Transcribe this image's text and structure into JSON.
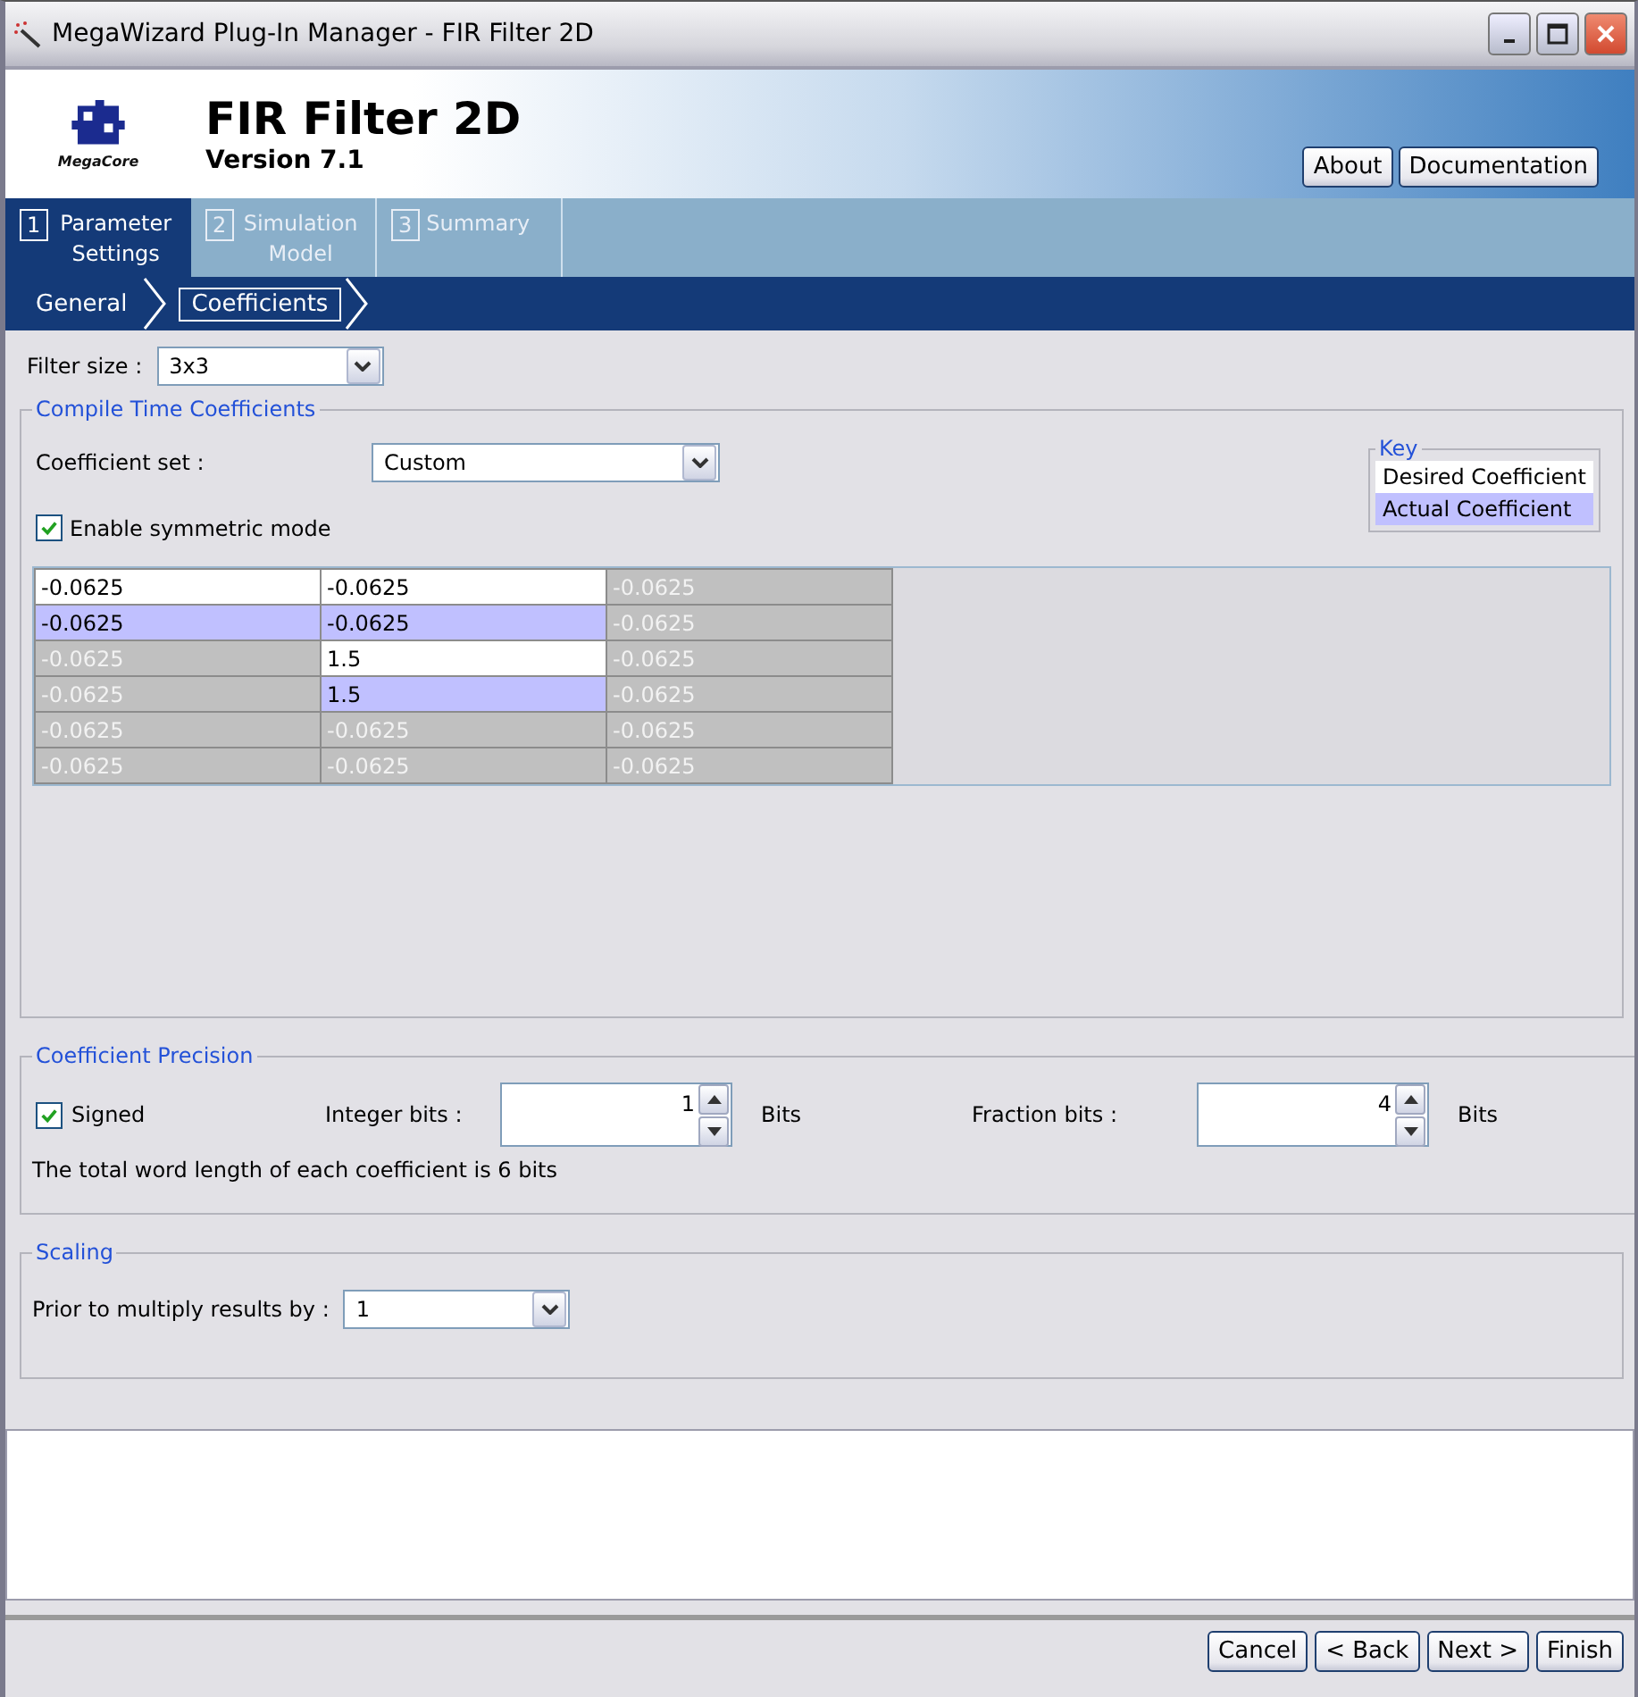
{
  "window": {
    "title": "MegaWizard Plug-In Manager - FIR Filter 2D"
  },
  "header": {
    "logo_caption": "MegaCore",
    "title": "FIR Filter 2D",
    "version": "Version 7.1",
    "buttons": [
      "About",
      "Documentation"
    ]
  },
  "steps": [
    {
      "number": "1",
      "label": "Parameter Settings",
      "selected": true
    },
    {
      "number": "2",
      "label": "Simulation Model",
      "selected": false
    },
    {
      "number": "3",
      "label": "Summary",
      "selected": false
    }
  ],
  "breadcrumb": [
    {
      "label": "General",
      "selected": false
    },
    {
      "label": "Coefficients",
      "selected": true
    }
  ],
  "filter_size": {
    "label": "Filter size :",
    "value": "3x3"
  },
  "compile_time": {
    "title": "Compile Time Coefficients",
    "coefficient_set": {
      "label": "Coefficient set :",
      "value": "Custom"
    },
    "symmetric": {
      "label": "Enable symmetric mode",
      "checked": true
    },
    "key": {
      "title": "Key",
      "items": [
        {
          "label": "Desired Coefficient",
          "kind": "desired"
        },
        {
          "label": "Actual Coefficient",
          "kind": "actual"
        }
      ]
    },
    "rows": [
      [
        {
          "value": "-0.0625",
          "kind": "desired"
        },
        {
          "value": "-0.0625",
          "kind": "desired"
        },
        {
          "value": "-0.0625",
          "kind": "disabled"
        }
      ],
      [
        {
          "value": "-0.0625",
          "kind": "actual"
        },
        {
          "value": "-0.0625",
          "kind": "actual"
        },
        {
          "value": "-0.0625",
          "kind": "disabled"
        }
      ],
      [
        {
          "value": "-0.0625",
          "kind": "disabled"
        },
        {
          "value": "1.5",
          "kind": "desired"
        },
        {
          "value": "-0.0625",
          "kind": "disabled"
        }
      ],
      [
        {
          "value": "-0.0625",
          "kind": "disabled"
        },
        {
          "value": "1.5",
          "kind": "actual"
        },
        {
          "value": "-0.0625",
          "kind": "disabled"
        }
      ],
      [
        {
          "value": "-0.0625",
          "kind": "disabled"
        },
        {
          "value": "-0.0625",
          "kind": "disabled"
        },
        {
          "value": "-0.0625",
          "kind": "disabled"
        }
      ],
      [
        {
          "value": "-0.0625",
          "kind": "disabled"
        },
        {
          "value": "-0.0625",
          "kind": "disabled"
        },
        {
          "value": "-0.0625",
          "kind": "disabled"
        }
      ]
    ]
  },
  "precision": {
    "title": "Coefficient Precision",
    "signed": {
      "label": "Signed",
      "checked": true
    },
    "integer_bits": {
      "label": "Integer bits :",
      "value": "1",
      "unit": "Bits"
    },
    "fraction_bits": {
      "label": "Fraction bits :",
      "value": "4",
      "unit": "Bits"
    },
    "summary": "The total word length of each coefficient is 6 bits"
  },
  "scaling": {
    "title": "Scaling",
    "label": "Prior to multiply results by :",
    "value": "1"
  },
  "footer_buttons": [
    "Cancel",
    "< Back",
    "Next >",
    "Finish"
  ]
}
